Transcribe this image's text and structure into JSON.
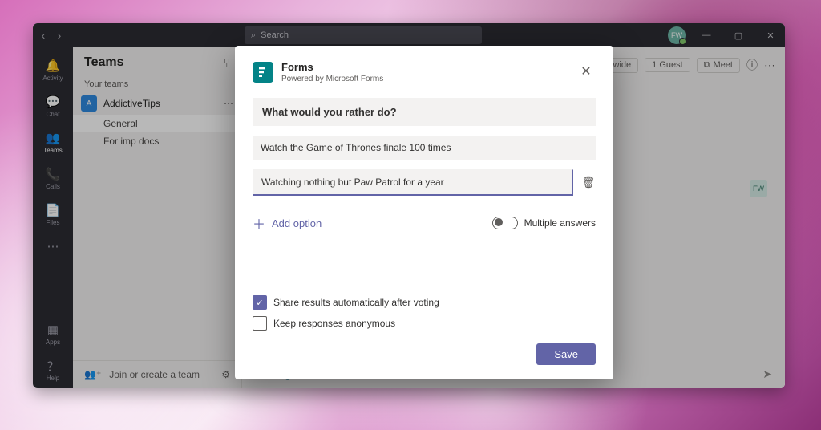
{
  "titlebar": {
    "search_placeholder": "Search",
    "avatar_initials": "FW"
  },
  "rail": {
    "items": [
      {
        "icon": "🔔",
        "label": "Activity"
      },
      {
        "icon": "💬",
        "label": "Chat"
      },
      {
        "icon": "👥",
        "label": "Teams"
      },
      {
        "icon": "📞",
        "label": "Calls"
      },
      {
        "icon": "📄",
        "label": "Files"
      },
      {
        "icon": "⋯",
        "label": ""
      }
    ],
    "bottom": [
      {
        "icon": "▦",
        "label": "Apps"
      },
      {
        "icon": "？",
        "label": "Help"
      }
    ]
  },
  "teams_panel": {
    "heading": "Teams",
    "section_label": "Your teams",
    "team": {
      "initial": "A",
      "name": "AddictiveTips"
    },
    "channels": [
      "General",
      "For imp docs"
    ],
    "join_label": "Join or create a team"
  },
  "channel_header": {
    "org_wide": "Org-wide",
    "guest": "1 Guest",
    "meet": "Meet"
  },
  "chat_preview_initials": "FW",
  "modal": {
    "title": "Forms",
    "subtitle": "Powered by Microsoft Forms",
    "question": "What would you rather do?",
    "options": [
      "Watch the Game of Thrones finale 100 times",
      "Watching nothing but Paw Patrol for a year"
    ],
    "add_option_label": "Add option",
    "multiple_answers_label": "Multiple answers",
    "share_results_label": "Share results automatically after voting",
    "keep_anonymous_label": "Keep responses anonymous",
    "save_label": "Save"
  }
}
